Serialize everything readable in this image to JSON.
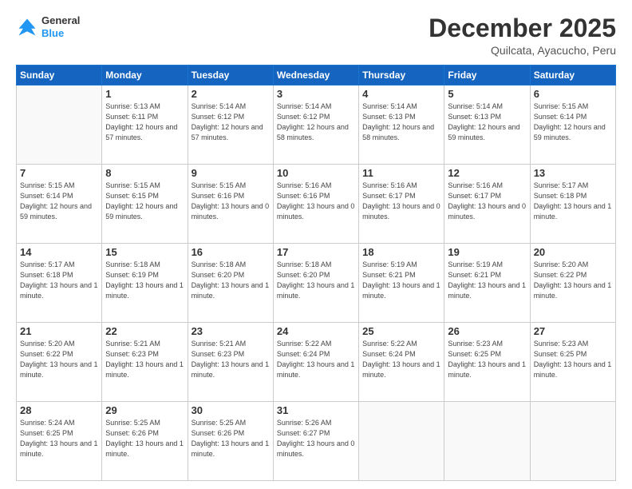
{
  "logo": {
    "general": "General",
    "blue": "Blue"
  },
  "header": {
    "month": "December 2025",
    "location": "Quilcata, Ayacucho, Peru"
  },
  "weekdays": [
    "Sunday",
    "Monday",
    "Tuesday",
    "Wednesday",
    "Thursday",
    "Friday",
    "Saturday"
  ],
  "weeks": [
    [
      {
        "day": "",
        "empty": true
      },
      {
        "day": "1",
        "sunrise": "5:13 AM",
        "sunset": "6:11 PM",
        "daylight": "12 hours and 57 minutes."
      },
      {
        "day": "2",
        "sunrise": "5:14 AM",
        "sunset": "6:12 PM",
        "daylight": "12 hours and 57 minutes."
      },
      {
        "day": "3",
        "sunrise": "5:14 AM",
        "sunset": "6:12 PM",
        "daylight": "12 hours and 58 minutes."
      },
      {
        "day": "4",
        "sunrise": "5:14 AM",
        "sunset": "6:13 PM",
        "daylight": "12 hours and 58 minutes."
      },
      {
        "day": "5",
        "sunrise": "5:14 AM",
        "sunset": "6:13 PM",
        "daylight": "12 hours and 59 minutes."
      },
      {
        "day": "6",
        "sunrise": "5:15 AM",
        "sunset": "6:14 PM",
        "daylight": "12 hours and 59 minutes."
      }
    ],
    [
      {
        "day": "7",
        "sunrise": "5:15 AM",
        "sunset": "6:14 PM",
        "daylight": "12 hours and 59 minutes."
      },
      {
        "day": "8",
        "sunrise": "5:15 AM",
        "sunset": "6:15 PM",
        "daylight": "12 hours and 59 minutes."
      },
      {
        "day": "9",
        "sunrise": "5:15 AM",
        "sunset": "6:16 PM",
        "daylight": "13 hours and 0 minutes."
      },
      {
        "day": "10",
        "sunrise": "5:16 AM",
        "sunset": "6:16 PM",
        "daylight": "13 hours and 0 minutes."
      },
      {
        "day": "11",
        "sunrise": "5:16 AM",
        "sunset": "6:17 PM",
        "daylight": "13 hours and 0 minutes."
      },
      {
        "day": "12",
        "sunrise": "5:16 AM",
        "sunset": "6:17 PM",
        "daylight": "13 hours and 0 minutes."
      },
      {
        "day": "13",
        "sunrise": "5:17 AM",
        "sunset": "6:18 PM",
        "daylight": "13 hours and 1 minute."
      }
    ],
    [
      {
        "day": "14",
        "sunrise": "5:17 AM",
        "sunset": "6:18 PM",
        "daylight": "13 hours and 1 minute."
      },
      {
        "day": "15",
        "sunrise": "5:18 AM",
        "sunset": "6:19 PM",
        "daylight": "13 hours and 1 minute."
      },
      {
        "day": "16",
        "sunrise": "5:18 AM",
        "sunset": "6:20 PM",
        "daylight": "13 hours and 1 minute."
      },
      {
        "day": "17",
        "sunrise": "5:18 AM",
        "sunset": "6:20 PM",
        "daylight": "13 hours and 1 minute."
      },
      {
        "day": "18",
        "sunrise": "5:19 AM",
        "sunset": "6:21 PM",
        "daylight": "13 hours and 1 minute."
      },
      {
        "day": "19",
        "sunrise": "5:19 AM",
        "sunset": "6:21 PM",
        "daylight": "13 hours and 1 minute."
      },
      {
        "day": "20",
        "sunrise": "5:20 AM",
        "sunset": "6:22 PM",
        "daylight": "13 hours and 1 minute."
      }
    ],
    [
      {
        "day": "21",
        "sunrise": "5:20 AM",
        "sunset": "6:22 PM",
        "daylight": "13 hours and 1 minute."
      },
      {
        "day": "22",
        "sunrise": "5:21 AM",
        "sunset": "6:23 PM",
        "daylight": "13 hours and 1 minute."
      },
      {
        "day": "23",
        "sunrise": "5:21 AM",
        "sunset": "6:23 PM",
        "daylight": "13 hours and 1 minute."
      },
      {
        "day": "24",
        "sunrise": "5:22 AM",
        "sunset": "6:24 PM",
        "daylight": "13 hours and 1 minute."
      },
      {
        "day": "25",
        "sunrise": "5:22 AM",
        "sunset": "6:24 PM",
        "daylight": "13 hours and 1 minute."
      },
      {
        "day": "26",
        "sunrise": "5:23 AM",
        "sunset": "6:25 PM",
        "daylight": "13 hours and 1 minute."
      },
      {
        "day": "27",
        "sunrise": "5:23 AM",
        "sunset": "6:25 PM",
        "daylight": "13 hours and 1 minute."
      }
    ],
    [
      {
        "day": "28",
        "sunrise": "5:24 AM",
        "sunset": "6:25 PM",
        "daylight": "13 hours and 1 minute."
      },
      {
        "day": "29",
        "sunrise": "5:25 AM",
        "sunset": "6:26 PM",
        "daylight": "13 hours and 1 minute."
      },
      {
        "day": "30",
        "sunrise": "5:25 AM",
        "sunset": "6:26 PM",
        "daylight": "13 hours and 1 minute."
      },
      {
        "day": "31",
        "sunrise": "5:26 AM",
        "sunset": "6:27 PM",
        "daylight": "13 hours and 0 minutes."
      },
      {
        "day": "",
        "empty": true
      },
      {
        "day": "",
        "empty": true
      },
      {
        "day": "",
        "empty": true
      }
    ]
  ]
}
